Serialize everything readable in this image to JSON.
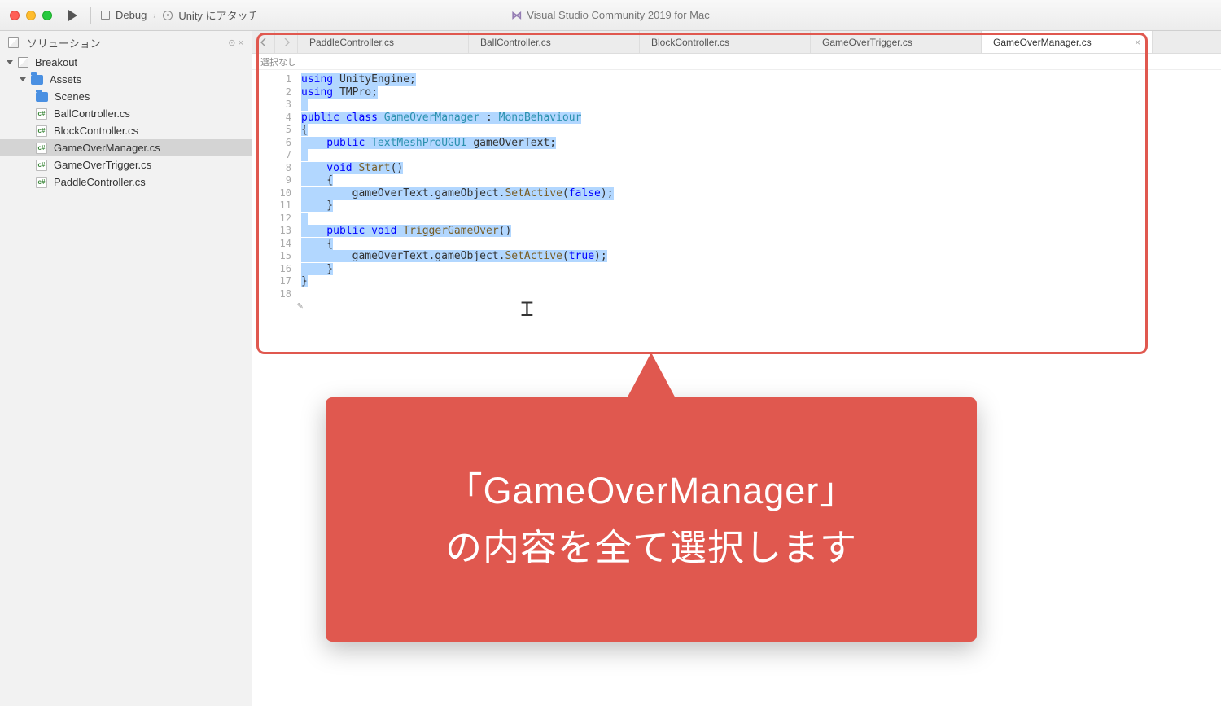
{
  "titlebar": {
    "config_label": "Debug",
    "attach_label": "Unity にアタッチ",
    "separator": "›",
    "window_title": "Visual Studio Community 2019 for Mac"
  },
  "sidebar": {
    "panel_title": "ソリューション",
    "root": "Breakout",
    "folder_assets": "Assets",
    "folder_scenes": "Scenes",
    "files": {
      "ball": "BallController.cs",
      "block": "BlockController.cs",
      "gom": "GameOverManager.cs",
      "got": "GameOverTrigger.cs",
      "paddle": "PaddleController.cs"
    }
  },
  "tabs": {
    "paddle": "PaddleController.cs",
    "ball": "BallController.cs",
    "block": "BlockController.cs",
    "got": "GameOverTrigger.cs",
    "gom": "GameOverManager.cs"
  },
  "breadcrumb": "選択なし",
  "gutter": [
    "1",
    "2",
    "3",
    "4",
    "5",
    "6",
    "7",
    "8",
    "9",
    "10",
    "11",
    "12",
    "13",
    "14",
    "15",
    "16",
    "17",
    "18"
  ],
  "code": {
    "l1a": "using",
    "l1b": " UnityEngine;",
    "l2a": "using",
    "l2b": " TMPro;",
    "l4a": "public",
    "l4b": " class",
    "l4c": " GameOverManager",
    "l4d": " : ",
    "l4e": "MonoBehaviour",
    "l5": "{",
    "l6a": "    public",
    "l6b": " TextMeshProUGUI",
    "l6c": " gameOverText;",
    "l8a": "    void",
    "l8b": " Start",
    "l8c": "()",
    "l9": "    {",
    "l10a": "        gameOverText.gameObject.",
    "l10b": "SetActive",
    "l10c": "(",
    "l10d": "false",
    "l10e": ");",
    "l11": "    }",
    "l13a": "    public",
    "l13b": " void",
    "l13c": " TriggerGameOver",
    "l13d": "()",
    "l14": "    {",
    "l15a": "        gameOverText.gameObject.",
    "l15b": "SetActive",
    "l15c": "(",
    "l15d": "true",
    "l15e": ");",
    "l16": "    }",
    "l17": "}"
  },
  "callout": {
    "line1": "「GameOverManager」",
    "line2": "の内容を全て選択します"
  }
}
